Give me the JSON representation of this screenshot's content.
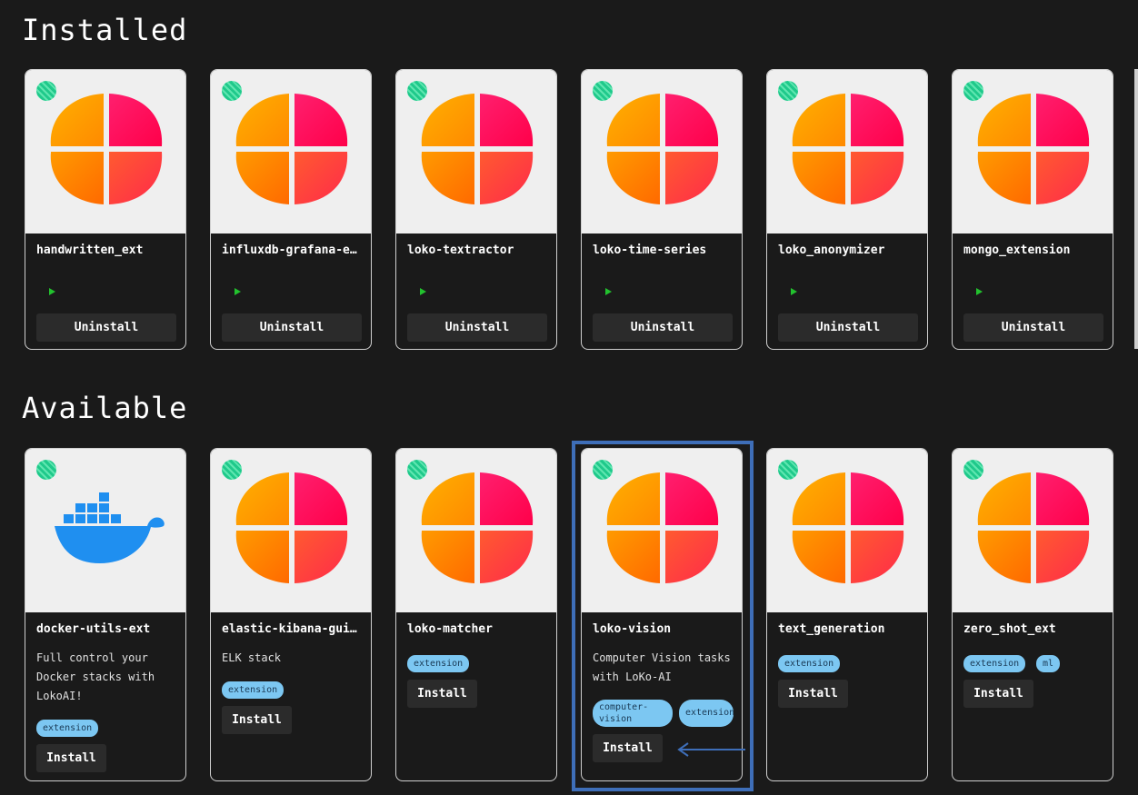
{
  "sections": {
    "installed_title": "Installed",
    "available_title": "Available"
  },
  "installed": [
    {
      "name": "handwritten_ext",
      "button": "Uninstall",
      "icon": "loko-logo"
    },
    {
      "name": "influxdb-grafana-ext",
      "button": "Uninstall",
      "icon": "loko-logo"
    },
    {
      "name": "loko-textractor",
      "button": "Uninstall",
      "icon": "loko-logo"
    },
    {
      "name": "loko-time-series",
      "button": "Uninstall",
      "icon": "loko-logo"
    },
    {
      "name": "loko_anonymizer",
      "button": "Uninstall",
      "icon": "loko-logo"
    },
    {
      "name": "mongo_extension",
      "button": "Uninstall",
      "icon": "loko-logo"
    }
  ],
  "available": [
    {
      "name": "docker-utils-ext",
      "description": "Full control your Docker stacks with LokoAI!",
      "tags": [
        "extension"
      ],
      "button": "Install",
      "icon": "docker-logo"
    },
    {
      "name": "elastic-kibana-gui-ext",
      "description": "ELK stack",
      "tags": [
        "extension"
      ],
      "button": "Install",
      "icon": "loko-logo"
    },
    {
      "name": "loko-matcher",
      "description": "",
      "tags": [
        "extension"
      ],
      "button": "Install",
      "icon": "loko-logo"
    },
    {
      "name": "loko-vision",
      "description": "Computer Vision tasks with LoKo-AI",
      "tags": [
        "computer-vision",
        "extension"
      ],
      "button": "Install",
      "icon": "loko-logo"
    },
    {
      "name": "text_generation",
      "description": "",
      "tags": [
        "extension"
      ],
      "button": "Install",
      "icon": "loko-logo"
    },
    {
      "name": "zero_shot_ext",
      "description": "",
      "tags": [
        "extension",
        "ml"
      ],
      "button": "Install",
      "icon": "loko-logo"
    }
  ],
  "colors": {
    "background": "#1a1a1a",
    "card_border": "#cfcfcf",
    "thumb_bg": "#efefef",
    "tag_bg": "#7cc7f2",
    "highlight": "#3e6eb8",
    "play": "#22c22e"
  }
}
